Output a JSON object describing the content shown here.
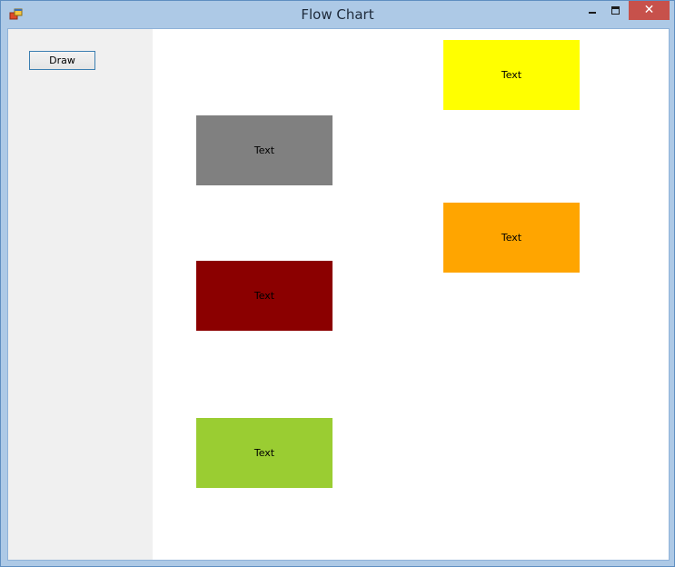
{
  "window": {
    "title": "Flow Chart",
    "close_glyph": "✕"
  },
  "toolbar": {
    "draw_label": "Draw"
  },
  "canvas": {
    "boxes": [
      {
        "label": "Text",
        "color": "#ffff00"
      },
      {
        "label": "Text",
        "color": "#808080"
      },
      {
        "label": "Text",
        "color": "#ffa500"
      },
      {
        "label": "Text",
        "color": "#8b0000"
      },
      {
        "label": "Text",
        "color": "#9acd32"
      }
    ]
  },
  "colors": {
    "frame": "#adc9e6",
    "close_button": "#c7514b",
    "panel": "#f0f0f0"
  },
  "icons": {
    "app": "app-icon",
    "minimize": "minimize-icon",
    "maximize": "maximize-icon",
    "close": "close-icon"
  }
}
